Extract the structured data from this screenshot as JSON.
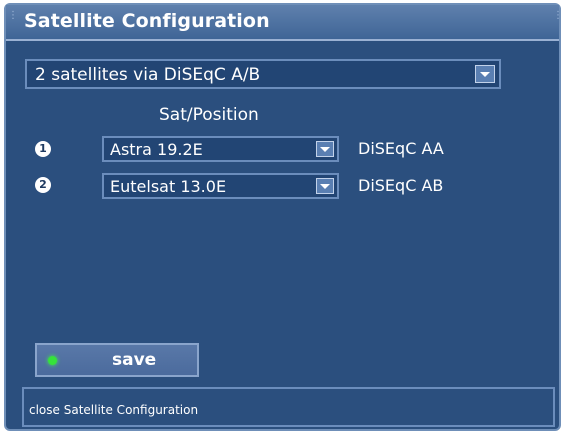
{
  "window": {
    "title": "Satellite Configuration"
  },
  "mode": {
    "selected": "2 satellites via DiSEqC A/B"
  },
  "table": {
    "column_header": "Sat/Position",
    "rows": [
      {
        "number": "1",
        "satellite": "Astra 19.2E",
        "diseqc": "DiSEqC AA"
      },
      {
        "number": "2",
        "satellite": "Eutelsat 13.0E",
        "diseqc": "DiSEqC AB"
      }
    ]
  },
  "save": {
    "label": "save",
    "led_color": "#35e33a"
  },
  "status": {
    "text": "close Satellite Configuration"
  },
  "colors": {
    "background": "#2b4f7e",
    "border": "#6b8dbc",
    "text": "#ffffff"
  },
  "icons": {
    "row1": "number-one-circle-icon",
    "row2": "number-two-circle-icon",
    "dropdown": "chevron-down-icon",
    "save_status": "green-led-icon"
  }
}
